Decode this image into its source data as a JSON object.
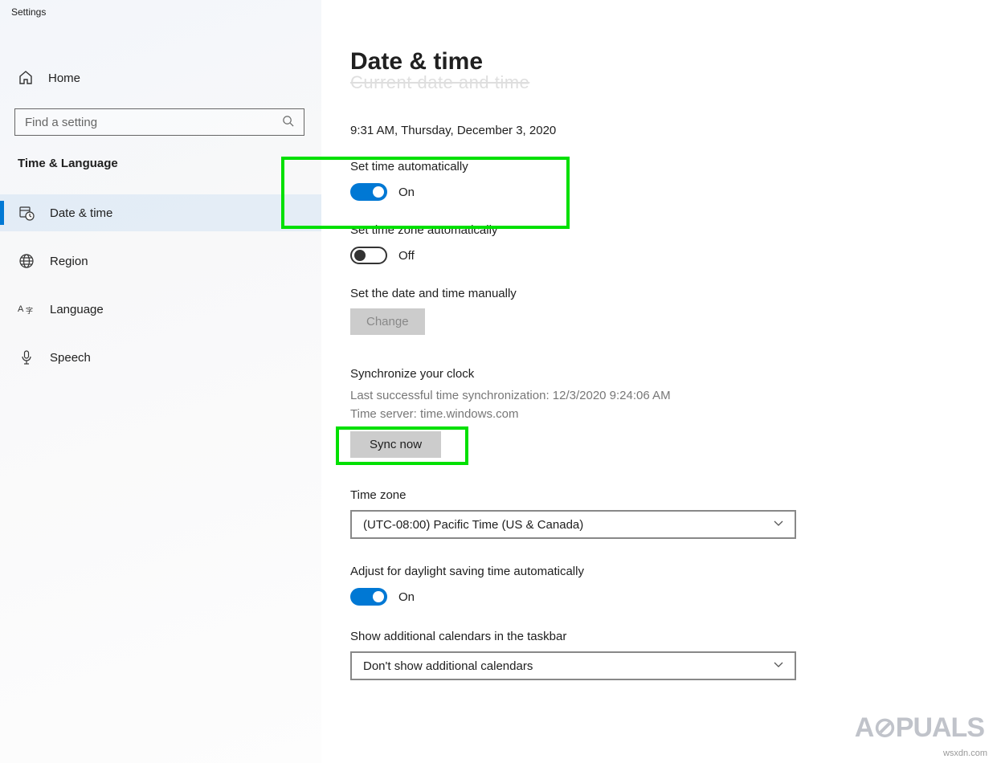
{
  "window": {
    "title": "Settings"
  },
  "sidebar": {
    "home": "Home",
    "search_placeholder": "Find a setting",
    "category": "Time & Language",
    "items": [
      {
        "label": "Date & time",
        "icon": "calendar-clock"
      },
      {
        "label": "Region",
        "icon": "globe"
      },
      {
        "label": "Language",
        "icon": "language-a"
      },
      {
        "label": "Speech",
        "icon": "microphone"
      }
    ]
  },
  "main": {
    "title": "Date & time",
    "cutoff_heading": "Current date and time",
    "current_datetime": "9:31 AM, Thursday, December 3, 2020",
    "set_time_auto": {
      "label": "Set time automatically",
      "state": "On"
    },
    "set_tz_auto": {
      "label": "Set time zone automatically",
      "state": "Off"
    },
    "manual": {
      "label": "Set the date and time manually",
      "button": "Change"
    },
    "sync": {
      "title": "Synchronize your clock",
      "last_sync": "Last successful time synchronization: 12/3/2020 9:24:06 AM",
      "server": "Time server: time.windows.com",
      "button": "Sync now"
    },
    "timezone": {
      "label": "Time zone",
      "value": "(UTC-08:00) Pacific Time (US & Canada)"
    },
    "daylight": {
      "label": "Adjust for daylight saving time automatically",
      "state": "On"
    },
    "calendars": {
      "label": "Show additional calendars in the taskbar",
      "value": "Don't show additional calendars"
    }
  },
  "watermark": {
    "brand": "A⊘PUALS",
    "url": "wsxdn.com"
  }
}
